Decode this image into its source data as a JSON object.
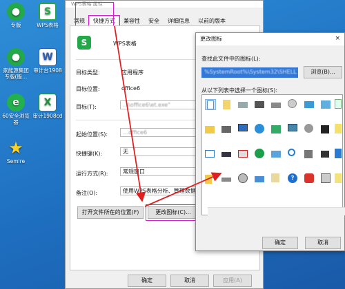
{
  "desktop": {
    "icons": [
      {
        "label": "专版",
        "glyph": "●",
        "style": "green"
      },
      {
        "label": "WPS表格",
        "glyph": "S",
        "style": "wps"
      },
      {
        "label": "家能源集团 专版(版…",
        "glyph": "●",
        "style": "green"
      },
      {
        "label": "审计台1908",
        "glyph": "W",
        "style": "doc"
      },
      {
        "label": "60安全浏览 器",
        "glyph": "e",
        "style": "ie"
      },
      {
        "label": "审计1908cd",
        "glyph": "X",
        "style": "xls"
      },
      {
        "label": "Semire",
        "glyph": "★",
        "style": "star"
      }
    ]
  },
  "properties": {
    "title": "WPS表格 属性",
    "tabs": [
      "常规",
      "快捷方式",
      "兼容性",
      "安全",
      "详细信息",
      "以前的版本"
    ],
    "active_tab": "快捷方式",
    "app_name": "WPS表格",
    "target_type_label": "目标类型:",
    "target_type_value": "应用程序",
    "target_location_label": "目标位置:",
    "target_location_value": "office6",
    "target_label": "目标(T):",
    "target_value": "…\\office6\\et.exe\"",
    "start_in_label": "起始位置(S):",
    "start_in_value": "…office6",
    "shortcut_key_label": "快捷键(K):",
    "shortcut_key_value": "无",
    "run_label": "运行方式(R):",
    "run_value": "常规窗口",
    "comment_label": "备注(O):",
    "comment_value": "使用WPS表格分析、管理数据",
    "open_location_button": "打开文件所在的位置(F)",
    "change_icon_button": "更改图标(C)...",
    "ok_button": "确定",
    "cancel_button": "取消",
    "apply_button": "应用(A)"
  },
  "change_icon_dialog": {
    "title": "更改图标",
    "close_glyph": "×",
    "find_label": "查找此文件中的图标(L):",
    "file_value": "%SystemRoot%\\System32\\SHELL32.dll",
    "browse_button": "浏览(B)...",
    "select_label": "从以下列表中选择一个图标(S):",
    "ok_button": "确定",
    "cancel_button": "取消"
  },
  "colors": {
    "highlight": "#d61fd0",
    "arrow": "#e02020",
    "selection": "#3378d6"
  }
}
